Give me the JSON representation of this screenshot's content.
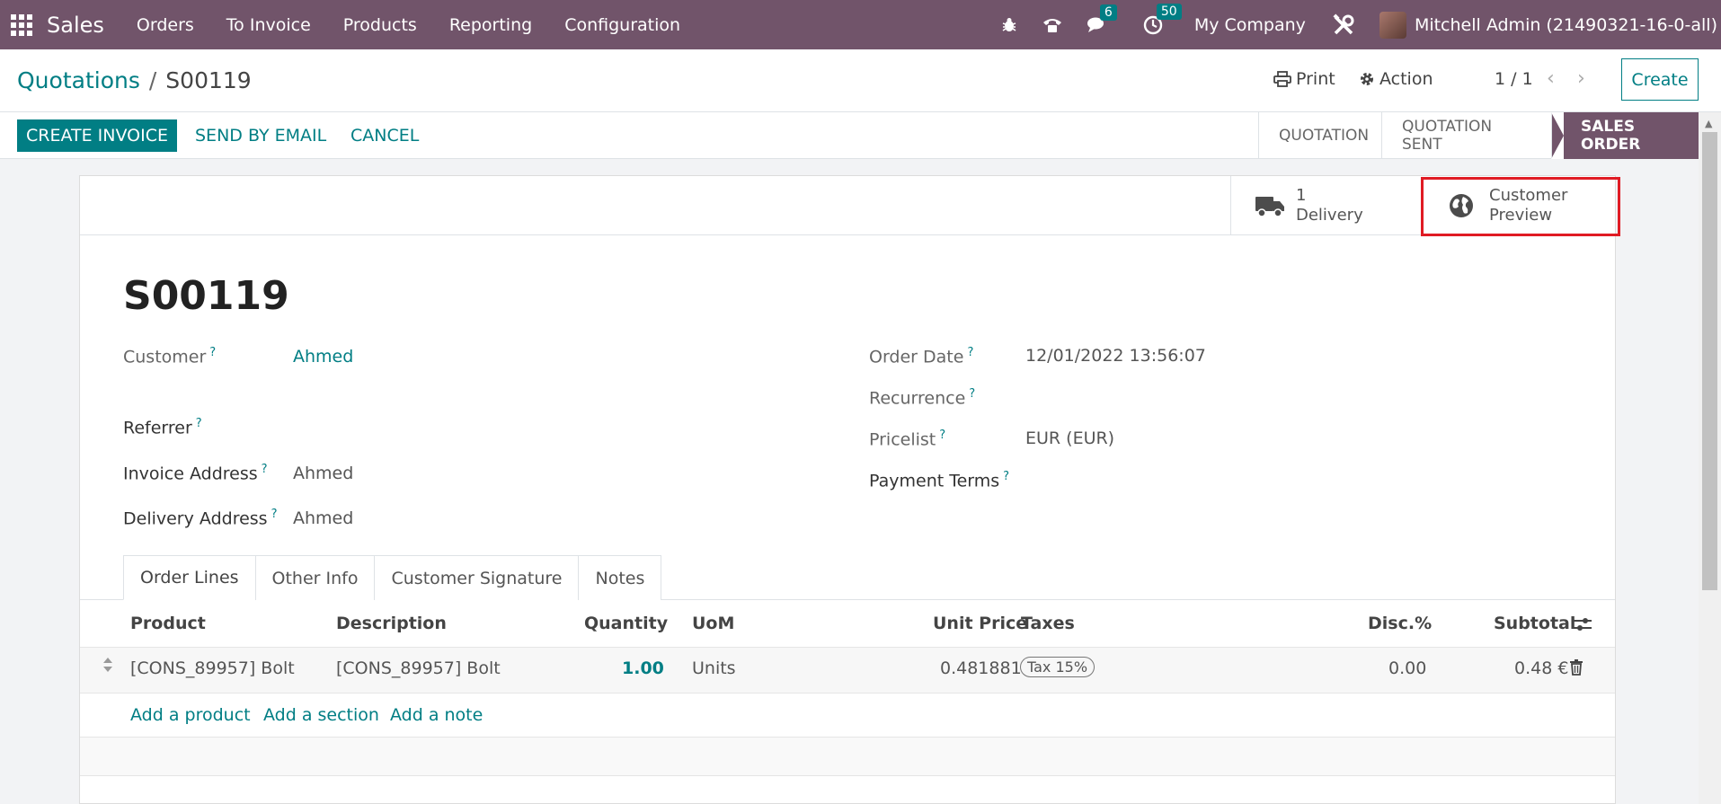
{
  "navbar": {
    "app_name": "Sales",
    "menu": [
      "Orders",
      "To Invoice",
      "Products",
      "Reporting",
      "Configuration"
    ],
    "messages_count": "6",
    "activities_count": "50",
    "company": "My Company",
    "user": "Mitchell Admin (21490321-16-0-all)"
  },
  "breadcrumb": {
    "parent": "Quotations",
    "separator": "/",
    "current": "S00119"
  },
  "control": {
    "print_label": "Print",
    "action_label": "Action",
    "pager": "1 / 1",
    "create_label": "Create"
  },
  "statusbar": {
    "create_invoice": "CREATE INVOICE",
    "send_by_email": "SEND BY EMAIL",
    "cancel": "CANCEL",
    "stages": [
      "QUOTATION",
      "QUOTATION SENT",
      "SALES ORDER"
    ],
    "active_stage": "SALES ORDER"
  },
  "smart_buttons": {
    "delivery_count": "1",
    "delivery_label": "Delivery",
    "preview_line1": "Customer",
    "preview_line2": "Preview"
  },
  "form": {
    "name": "S00119",
    "customer_label": "Customer",
    "customer_value": "Ahmed",
    "referrer_label": "Referrer",
    "invoice_address_label": "Invoice Address",
    "invoice_address_value": "Ahmed",
    "delivery_address_label": "Delivery Address",
    "delivery_address_value": "Ahmed",
    "order_date_label": "Order Date",
    "order_date_value": "12/01/2022 13:56:07",
    "recurrence_label": "Recurrence",
    "pricelist_label": "Pricelist",
    "pricelist_value": "EUR (EUR)",
    "payment_terms_label": "Payment Terms",
    "help_mark": "?"
  },
  "tabs": [
    "Order Lines",
    "Other Info",
    "Customer Signature",
    "Notes"
  ],
  "order_lines": {
    "headers": {
      "product": "Product",
      "description": "Description",
      "quantity": "Quantity",
      "uom": "UoM",
      "unit_price": "Unit Price",
      "taxes": "Taxes",
      "discount": "Disc.%",
      "subtotal": "Subtotal"
    },
    "rows": [
      {
        "product": "[CONS_89957] Bolt",
        "description": "[CONS_89957] Bolt",
        "quantity": "1.00",
        "uom": "Units",
        "unit_price": "0.481881",
        "tax": "Tax 15%",
        "discount": "0.00",
        "subtotal": "0.48 €"
      }
    ],
    "add_product": "Add a product",
    "add_section": "Add a section",
    "add_note": "Add a note"
  },
  "colors": {
    "navbar": "#71546a",
    "primary": "#017e84",
    "highlight": "#e01b24"
  }
}
